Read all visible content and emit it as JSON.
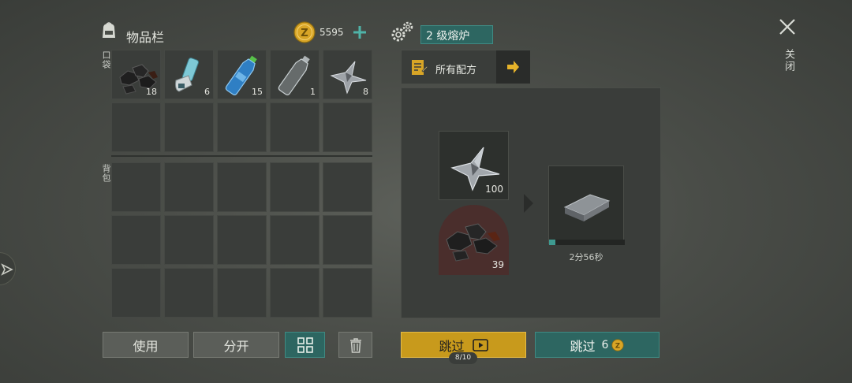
{
  "inventory": {
    "title": "物品栏",
    "coins": "5595",
    "pocket_label": "口袋",
    "backpack_label": "背包",
    "pocket_items": [
      {
        "icon": "coal-icon",
        "count": "18"
      },
      {
        "icon": "inhaler-icon",
        "count": "6"
      },
      {
        "icon": "water-bottle-icon",
        "count": "15"
      },
      {
        "icon": "empty-bottle-icon",
        "count": "1"
      },
      {
        "icon": "iron-ore-icon",
        "count": "8"
      }
    ]
  },
  "actions": {
    "use": "使用",
    "split": "分开"
  },
  "furnace": {
    "title": "2 级熔炉",
    "recipes_label": "所有配方",
    "input_ore_count": "100",
    "fuel_count": "39",
    "output_item": "iron-bar-icon",
    "timer": "2分56秒",
    "progress": 0.08
  },
  "skip_ad": {
    "label": "跳过",
    "counter": "8/10"
  },
  "skip_coin": {
    "label": "跳过",
    "cost": "6"
  },
  "close": {
    "label": "关闭"
  },
  "colors": {
    "accent_teal": "#2d6661",
    "accent_gold": "#c89a1c",
    "coin": "#d8a526"
  }
}
